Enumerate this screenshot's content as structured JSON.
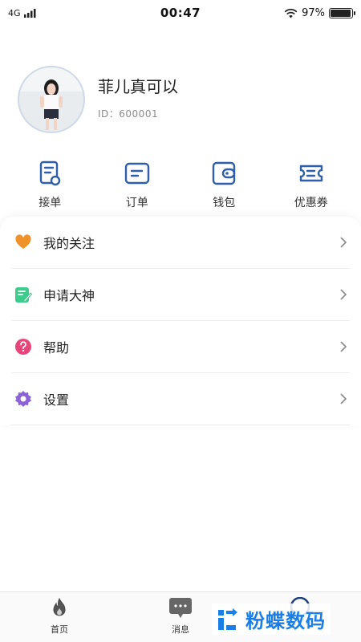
{
  "status_bar": {
    "network": "4G",
    "time": "00:47",
    "battery_percent": "97%",
    "battery_level": 0.97
  },
  "profile": {
    "nickname": "菲儿真可以",
    "user_id": "ID：600001"
  },
  "quick_actions": [
    {
      "label": "接单",
      "icon": "receipt-icon"
    },
    {
      "label": "订单",
      "icon": "order-icon"
    },
    {
      "label": "钱包",
      "icon": "wallet-icon"
    },
    {
      "label": "优惠券",
      "icon": "coupon-icon"
    }
  ],
  "menu": [
    {
      "label": "我的关注",
      "icon": "heart-icon",
      "color": "#f0922a"
    },
    {
      "label": "申请大神",
      "icon": "edit-note-icon",
      "color": "#3ecb8e"
    },
    {
      "label": "帮助",
      "icon": "help-icon",
      "color": "#e8457a"
    },
    {
      "label": "设置",
      "icon": "settings-icon",
      "color": "#8b63d6"
    }
  ],
  "tab_bar": {
    "home_label": "首页",
    "messages_label": "消息"
  },
  "watermark": {
    "text": "粉蝶数码"
  },
  "colors": {
    "accent_blue": "#2f5fa8",
    "watermark_blue": "#1a7ee6"
  }
}
